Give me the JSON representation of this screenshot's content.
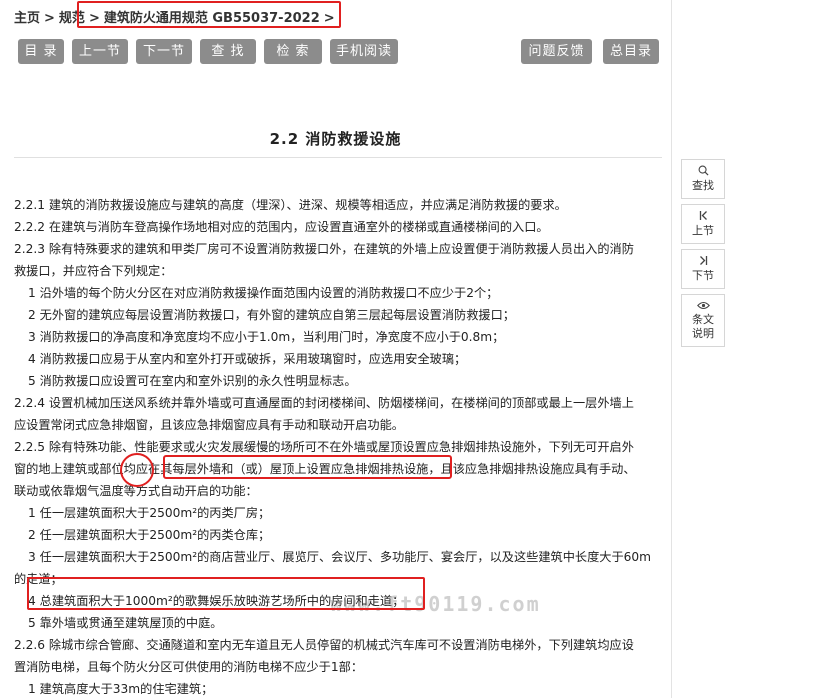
{
  "breadcrumb": {
    "home": "主页",
    "sep": ">",
    "category": "规范",
    "standard": "建筑防火通用规范 GB55037-2022",
    "tail": ">"
  },
  "toolbar": {
    "contents": "目 录",
    "prev": "上一节",
    "next": "下一节",
    "find": "查 找",
    "search": "检 索",
    "mobile": "手机阅读",
    "feedback": "问题反馈",
    "all_contents": "总目录"
  },
  "section_title": "2.2 消防救援设施",
  "content": {
    "lines": [
      "2.2.1 建筑的消防救援设施应与建筑的高度（埋深）、进深、规模等相适应，并应满足消防救援的要求。",
      "2.2.2 在建筑与消防车登高操作场地相对应的范围内，应设置直通室外的楼梯或直通楼梯间的入口。",
      "2.2.3 除有特殊要求的建筑和甲类厂房可不设置消防救援口外，在建筑的外墙上应设置便于消防救援人员出入的消防",
      "救援口，并应符合下列规定：",
      "1 沿外墙的每个防火分区在对应消防救援操作面范围内设置的消防救援口不应少于2个；",
      "2 无外窗的建筑应每层设置消防救援口，有外窗的建筑应自第三层起每层设置消防救援口；",
      "3 消防救援口的净高度和净宽度均不应小于1.0m，当利用门时，净宽度不应小于0.8m；",
      "4 消防救援口应易于从室内和室外打开或破拆，采用玻璃窗时，应选用安全玻璃；",
      "5 消防救援口应设置可在室内和室外识别的永久性明显标志。",
      "2.2.4 设置机械加压送风系统并靠外墙或可直通屋面的封闭楼梯间、防烟楼梯间，在楼梯间的顶部或最上一层外墙上",
      "应设置常闭式应急排烟窗，且该应急排烟窗应具有手动和联动开启功能。",
      "2.2.5 除有特殊功能、性能要求或火灾发展缓慢的场所可不在外墙或屋顶设置应急排烟排热设施外，下列无可开启外",
      "窗的地上建筑或部位均应在其每层外墙和（或）屋顶上设置应急排烟排热设施，且该应急排烟排热设施应具有手动、",
      "联动或依靠烟气温度等方式自动开启的功能：",
      "1 任一层建筑面积大于2500m²的丙类厂房；",
      "2 任一层建筑面积大于2500m²的丙类仓库；",
      "3 任一层建筑面积大于2500m²的商店营业厅、展览厅、会议厅、多功能厅、宴会厅，以及这些建筑中长度大于60m",
      "的走道；",
      "4 总建筑面积大于1000m²的歌舞娱乐放映游艺场所中的房间和走道；",
      "5 靠外墙或贯通至建筑屋顶的中庭。",
      "2.2.6 除城市综合管廊、交通隧道和室内无车道且无人员停留的机械式汽车库可不设置消防电梯外，下列建筑均应设",
      "置消防电梯，且每个防火分区可供使用的消防电梯不应少于1部：",
      "1 建筑高度大于33m的住宅建筑；"
    ]
  },
  "side_panel": {
    "find": "查找",
    "prev": "上节",
    "next": "下节",
    "explain_1": "条文",
    "explain_2": "说明"
  },
  "watermark": "www.ft90119.com",
  "colors": {
    "button_bg": "#8c8c8c",
    "annotation": "#e02020"
  },
  "icons": {
    "find": "magnifier-icon",
    "prev": "skip-up-icon",
    "next": "skip-down-icon",
    "explain": "eye-icon"
  }
}
